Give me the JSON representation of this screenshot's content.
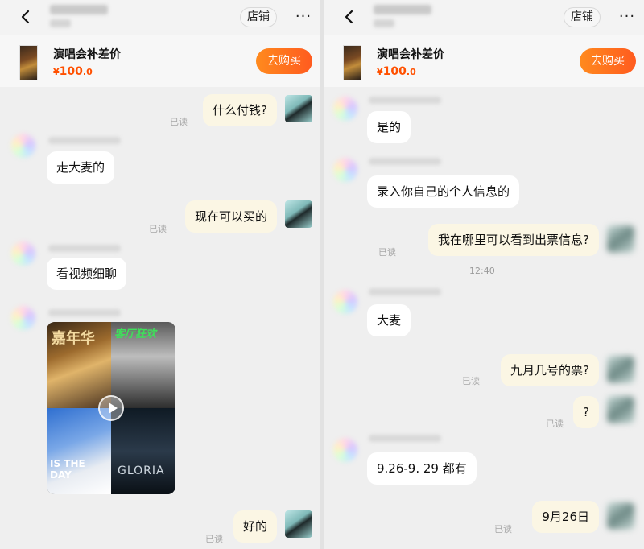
{
  "header": {
    "shop_label": "店铺",
    "more_label": "···"
  },
  "product": {
    "title": "演唱会补差价",
    "currency": "¥",
    "price_int": "100",
    "price_dec": ".0",
    "buy_label": "去购买"
  },
  "left_chat": {
    "messages": [
      {
        "text": "什么付钱?",
        "read": "已读"
      },
      {
        "text": "走大麦的"
      },
      {
        "text": "现在可以买的",
        "read": "已读"
      },
      {
        "text": "看视频细聊"
      },
      {
        "text": "好的",
        "read": "已读"
      }
    ],
    "media_card": {
      "top_left_text": "嘉年华",
      "top_right_text": "客厅狂欢",
      "bottom_left_text": "IS THE DAY",
      "bottom_right_text": "GLORIA"
    }
  },
  "right_chat": {
    "messages": [
      {
        "text": "是的"
      },
      {
        "text": "录入你自己的个人信息的"
      },
      {
        "text": "我在哪里可以看到出票信息?",
        "read": "已读"
      },
      {
        "text": "大麦"
      },
      {
        "text": "九月几号的票?",
        "read": "已读"
      },
      {
        "text": "?",
        "read": "已读"
      },
      {
        "text": "9.26-9. 29 都有"
      },
      {
        "text": "9月26日",
        "read": "已读"
      }
    ],
    "time": "12:40"
  }
}
